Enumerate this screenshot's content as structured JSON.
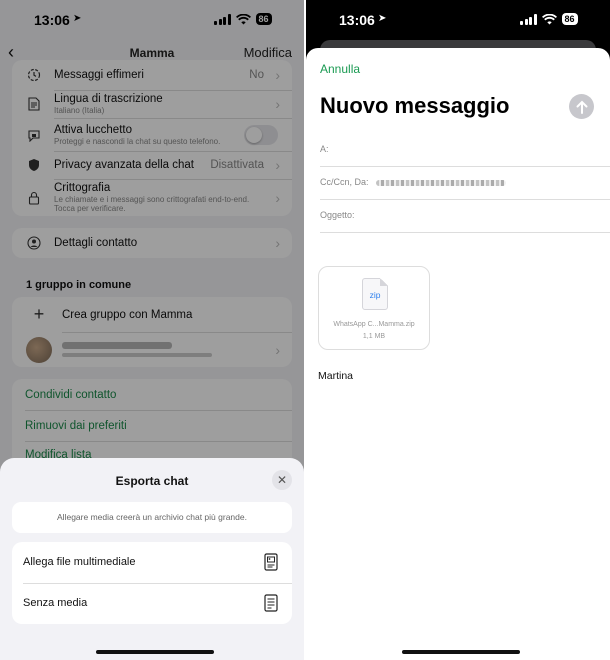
{
  "left": {
    "status": {
      "time": "13:06",
      "battery": "86"
    },
    "nav": {
      "back": "‹",
      "title": "Mamma",
      "edit": "Modifica"
    },
    "settings": [
      {
        "label": "Messaggi effimeri",
        "value": "No",
        "icon": "timer-icon"
      },
      {
        "label": "Lingua di trascrizione",
        "sub": "Italiano (Italia)",
        "icon": "document-icon"
      },
      {
        "label": "Attiva lucchetto",
        "sub": "Proteggi e nascondi la chat su questo telefono.",
        "icon": "chat-lock-icon"
      },
      {
        "label": "Privacy avanzata della chat",
        "value": "Disattivata",
        "icon": "shield-icon"
      },
      {
        "label": "Crittografia",
        "sub": "Le chiamate e i messaggi sono crittografati end-to-end. Tocca per verificare.",
        "icon": "lock-icon"
      }
    ],
    "contact_details": "Dettagli contatto",
    "groups_header": "1 gruppo in comune",
    "create_group": "Crea gruppo con Mamma",
    "actions": [
      "Condividi contatto",
      "Rimuovi dai preferiti",
      "Modifica lista"
    ],
    "sheet": {
      "title": "Esporta chat",
      "note": "Allegare media creerà un archivio chat più grande.",
      "options": [
        {
          "label": "Allega file multimediale",
          "icon": "media-file-icon"
        },
        {
          "label": "Senza media",
          "icon": "text-file-icon"
        }
      ]
    }
  },
  "right": {
    "status": {
      "time": "13:06",
      "battery": "86"
    },
    "cancel": "Annulla",
    "subject_title": "Nuovo messaggio",
    "fields": {
      "to": "A:",
      "cc": "Cc/Ccn, Da:",
      "subject": "Oggetto:"
    },
    "attachment": {
      "type": "zip",
      "name": "WhatsApp C...Mamma.zip",
      "size": "1,1 MB"
    },
    "signature": "Martina",
    "accent": "#1a9a52"
  }
}
